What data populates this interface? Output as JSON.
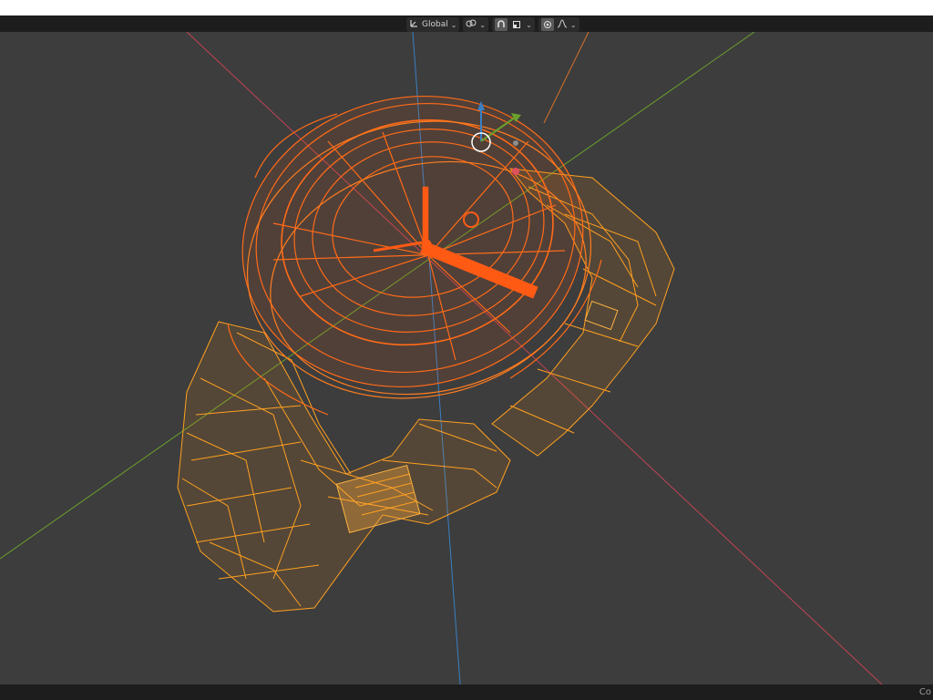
{
  "header": {
    "transform_orientation": {
      "label": "Global",
      "icon": "transform-orientation-icon"
    },
    "pivot_icon": "pivot-link-icon",
    "snap_icons": [
      "snap-magnet-icon",
      "snap-target-icon"
    ],
    "proportional_edit_icons": [
      "proportional-edit-icon",
      "falloff-curve-icon"
    ]
  },
  "viewport": {
    "shading": "wireframe",
    "object": "watch",
    "selection_color": "#ff8a1a",
    "active_color": "#ff5a14",
    "axis_colors": {
      "x": "#c04354",
      "y": "#6aa02c",
      "z": "#3b7fc4"
    },
    "gizmo_icons": [
      "move-gizmo-icon",
      "3d-cursor-icon"
    ]
  },
  "statusbar": {
    "right_text": "Co"
  }
}
